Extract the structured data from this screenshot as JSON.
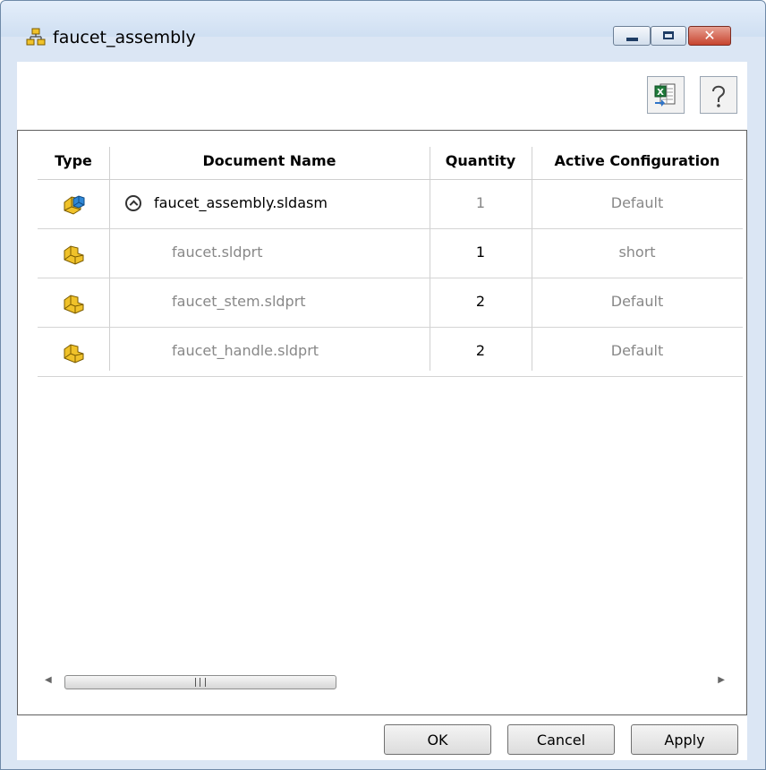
{
  "window": {
    "title": "faucet_assembly",
    "controls": {
      "minimize": "minimize",
      "maximize": "maximize",
      "close": "✕"
    }
  },
  "toolbar": {
    "excel_icon": "excel-export-icon",
    "help_icon": "help-icon"
  },
  "table": {
    "columns": [
      "Type",
      "Document Name",
      "Quantity",
      "Active Configuration"
    ],
    "rows": [
      {
        "type_icon": "assembly-icon",
        "name": "faucet_assembly.sldasm",
        "quantity": "1",
        "configuration": "Default"
      },
      {
        "type_icon": "part-icon",
        "name": "faucet.sldprt",
        "quantity": "1",
        "configuration": "short"
      },
      {
        "type_icon": "part-icon",
        "name": "faucet_stem.sldprt",
        "quantity": "2",
        "configuration": "Default"
      },
      {
        "type_icon": "part-icon",
        "name": "faucet_handle.sldprt",
        "quantity": "2",
        "configuration": "Default"
      }
    ]
  },
  "buttons": {
    "ok": "OK",
    "cancel": "Cancel",
    "apply": "Apply"
  },
  "colors": {
    "part_icon": "#f0c22a",
    "assembly_icon": "#2f87d6",
    "muted_text": "#888888"
  }
}
